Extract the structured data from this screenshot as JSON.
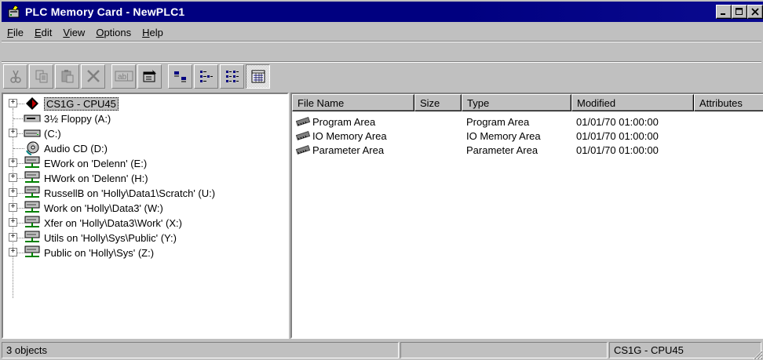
{
  "window": {
    "title": "PLC Memory Card - NewPLC1"
  },
  "menu": [
    {
      "pre": "",
      "key": "F",
      "post": "ile"
    },
    {
      "pre": "",
      "key": "E",
      "post": "dit"
    },
    {
      "pre": "",
      "key": "V",
      "post": "iew"
    },
    {
      "pre": "",
      "key": "O",
      "post": "ptions"
    },
    {
      "pre": "",
      "key": "H",
      "post": "elp"
    }
  ],
  "toolbar": {
    "buttons": [
      "cut-icon",
      "copy-icon",
      "paste-icon",
      "delete-icon",
      "rename-icon",
      "properties-icon",
      "large-icons-view-icon",
      "small-icons-view-icon",
      "list-view-icon",
      "details-view-icon"
    ],
    "pressed": "details-view-icon"
  },
  "tree": [
    {
      "label": "CS1G - CPU45",
      "icon": "plc-icon",
      "expander": "+",
      "selected": true
    },
    {
      "label": "3½ Floppy (A:)",
      "icon": "floppy-drive-icon",
      "expander": ""
    },
    {
      "label": "(C:)",
      "icon": "hard-drive-icon",
      "expander": "+"
    },
    {
      "label": "Audio CD (D:)",
      "icon": "cd-drive-icon",
      "expander": ""
    },
    {
      "label": "EWork on 'Delenn' (E:)",
      "icon": "network-drive-icon",
      "expander": "+"
    },
    {
      "label": "HWork on 'Delenn' (H:)",
      "icon": "network-drive-icon",
      "expander": "+"
    },
    {
      "label": "RussellB on 'Holly\\Data1\\Scratch' (U:)",
      "icon": "network-drive-icon",
      "expander": "+"
    },
    {
      "label": "Work on 'Holly\\Data3' (W:)",
      "icon": "network-drive-icon",
      "expander": "+"
    },
    {
      "label": "Xfer on 'Holly\\Data3\\Work' (X:)",
      "icon": "network-drive-icon",
      "expander": "+"
    },
    {
      "label": "Utils on 'Holly\\Sys\\Public' (Y:)",
      "icon": "network-drive-icon",
      "expander": "+"
    },
    {
      "label": "Public on 'Holly\\Sys' (Z:)",
      "icon": "network-drive-icon",
      "expander": "+"
    }
  ],
  "list": {
    "columns": [
      "File Name",
      "Size",
      "Type",
      "Modified",
      "Attributes"
    ],
    "rows": [
      {
        "name": "Program Area",
        "size": "",
        "type": "Program Area",
        "modified": "01/01/70 01:00:00",
        "attributes": "",
        "icon": "memory-area-icon"
      },
      {
        "name": "IO Memory Area",
        "size": "",
        "type": "IO Memory Area",
        "modified": "01/01/70 01:00:00",
        "attributes": "",
        "icon": "memory-area-icon"
      },
      {
        "name": "Parameter Area",
        "size": "",
        "type": "Parameter Area",
        "modified": "01/01/70 01:00:00",
        "attributes": "",
        "icon": "memory-area-icon"
      }
    ]
  },
  "status": {
    "objects": "3 objects",
    "middle": "",
    "device": "CS1G - CPU45"
  },
  "colors": {
    "title_bar": "#000080",
    "face": "#c0c0c0",
    "window": "#ffffff"
  }
}
